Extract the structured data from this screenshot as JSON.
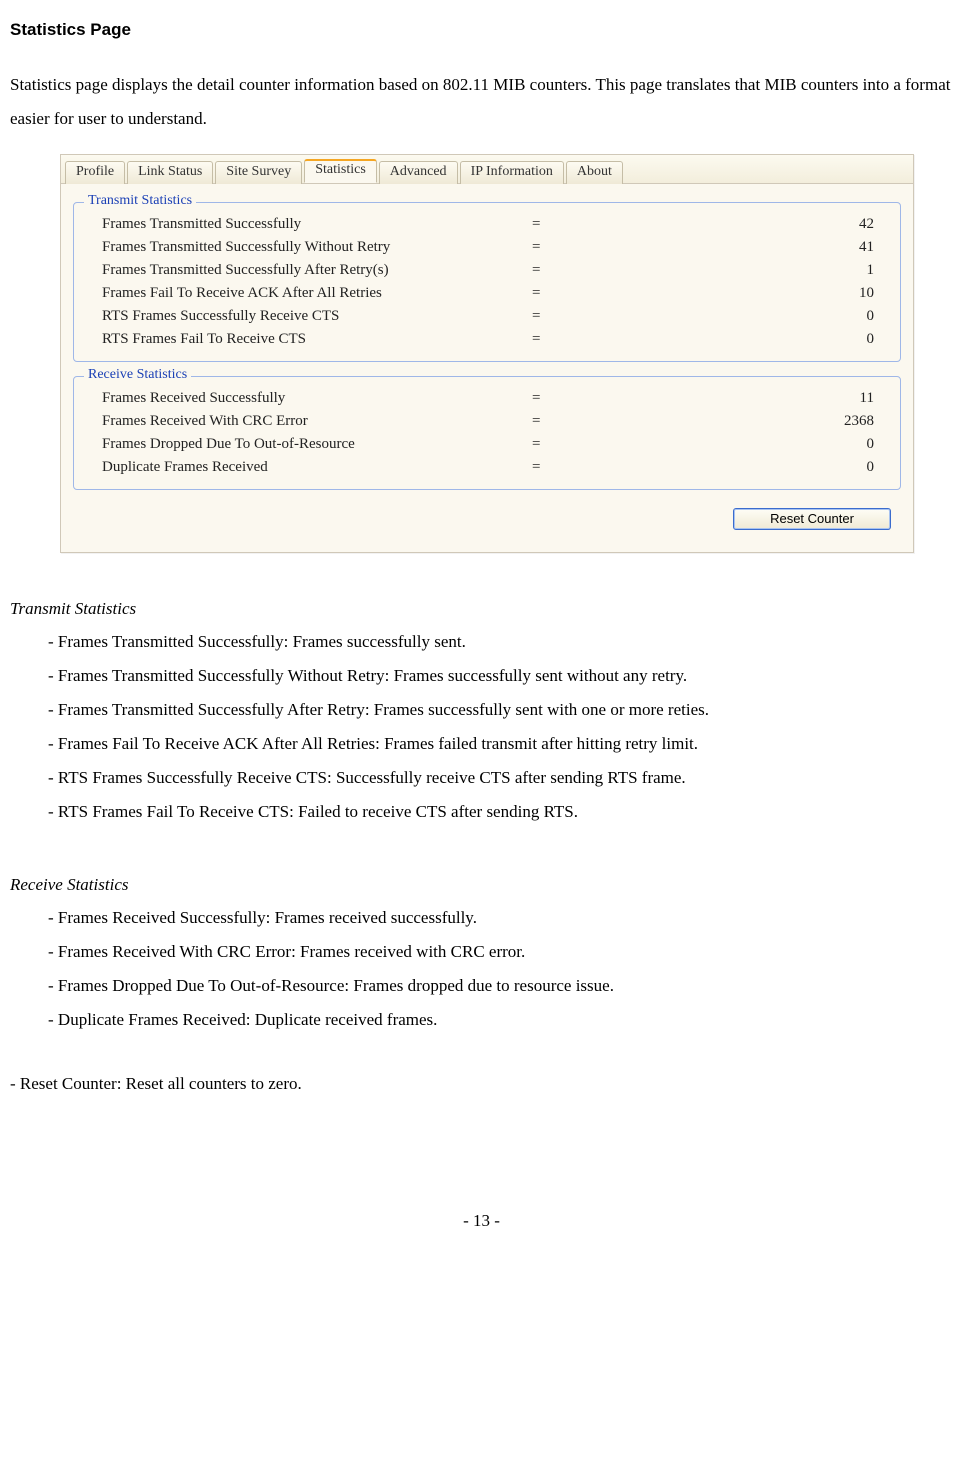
{
  "heading": "Statistics Page",
  "intro": "Statistics page displays the detail counter information based on 802.11 MIB counters. This page translates that MIB counters into a format easier for user to understand.",
  "tabs": {
    "profile": "Profile",
    "link_status": "Link Status",
    "site_survey": "Site Survey",
    "statistics": "Statistics",
    "advanced": "Advanced",
    "ip_info": "IP Information",
    "about": "About"
  },
  "tx_group_title": "Transmit Statistics",
  "rx_group_title": "Receive Statistics",
  "tx": [
    {
      "label": "Frames Transmitted Successfully",
      "value": "42"
    },
    {
      "label": "Frames Transmitted Successfully  Without Retry",
      "value": "41"
    },
    {
      "label": "Frames Transmitted Successfully After Retry(s)",
      "value": "1"
    },
    {
      "label": "Frames Fail To Receive ACK After All Retries",
      "value": "10"
    },
    {
      "label": "RTS Frames Successfully Receive CTS",
      "value": "0"
    },
    {
      "label": "RTS Frames Fail To Receive CTS",
      "value": "0"
    }
  ],
  "rx": [
    {
      "label": "Frames Received Successfully",
      "value": "11"
    },
    {
      "label": "Frames Received  With CRC Error",
      "value": "2368"
    },
    {
      "label": "Frames Dropped Due To Out-of-Resource",
      "value": "0"
    },
    {
      "label": "Duplicate Frames Received",
      "value": "0"
    }
  ],
  "reset_button": "Reset Counter",
  "explain_tx_title": "Transmit Statistics",
  "explain_tx": [
    "- Frames Transmitted Successfully: Frames successfully sent.",
    "- Frames Transmitted Successfully Without Retry: Frames successfully sent without any retry.",
    "- Frames Transmitted Successfully After Retry: Frames successfully sent with one or more reties.",
    "- Frames Fail To Receive ACK After All Retries: Frames failed transmit after hitting retry limit.",
    "- RTS Frames Successfully Receive CTS: Successfully receive CTS after sending RTS frame.",
    "- RTS Frames Fail To Receive CTS: Failed to receive CTS after sending RTS."
  ],
  "explain_rx_title": "Receive Statistics",
  "explain_rx": [
    "- Frames Received Successfully: Frames received successfully.",
    "- Frames Received With CRC Error: Frames received with CRC error.",
    "- Frames Dropped Due To Out-of-Resource: Frames dropped due to resource issue.",
    "- Duplicate Frames Received: Duplicate received frames."
  ],
  "reset_explain": "- Reset Counter: Reset all counters to zero.",
  "page_number": "- 13 -"
}
